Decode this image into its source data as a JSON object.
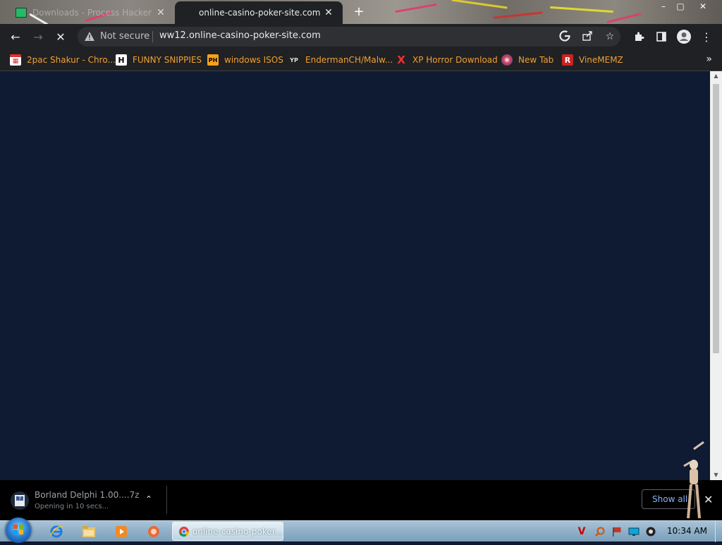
{
  "window": {
    "tabs": [
      {
        "label": "Downloads - Process Hacker",
        "active": false
      },
      {
        "label": "online-casino-poker-site.com",
        "active": true
      }
    ],
    "new_tab_symbol": "+",
    "controls": {
      "minimize": "–",
      "maximize": "▢",
      "close": "✕"
    }
  },
  "toolbar": {
    "back": "←",
    "forward": "→",
    "stop": "✕",
    "security_label": "Not secure",
    "url": "ww12.online-casino-poker-site.com",
    "icons": [
      "google-icon",
      "share-icon",
      "star-icon",
      "extensions-icon",
      "side-panel-icon",
      "profile-icon",
      "menu-icon"
    ]
  },
  "bookmarks": {
    "items": [
      {
        "label": "2pac Shakur - Chro...",
        "icon": "calendar-icon"
      },
      {
        "label": "FUNNY SNIPPIES",
        "icon": "h-icon"
      },
      {
        "label": "windows ISOS",
        "icon": "ph-icon"
      },
      {
        "label": "EndermanCH/Malw...",
        "icon": "yp-icon"
      },
      {
        "label": "XP Horror Download",
        "icon": "x-icon"
      },
      {
        "label": "New Tab",
        "icon": "globe-icon"
      },
      {
        "label": "VineMEMZ",
        "icon": "r-icon"
      }
    ],
    "overflow": "»"
  },
  "downloads": {
    "item_name": "Borland Delphi 1.00....7z",
    "item_status": "Opening in 10 secs...",
    "show_all_label": "Show all",
    "close": "✕"
  },
  "taskbar": {
    "active_window_label": "online-casino-poker...",
    "clock": "10:34 AM"
  },
  "colors": {
    "page_bg": "#0f1a33",
    "chrome_dark": "#202124",
    "bookmark_text": "#f0a030",
    "link_blue": "#8ab4f8"
  }
}
